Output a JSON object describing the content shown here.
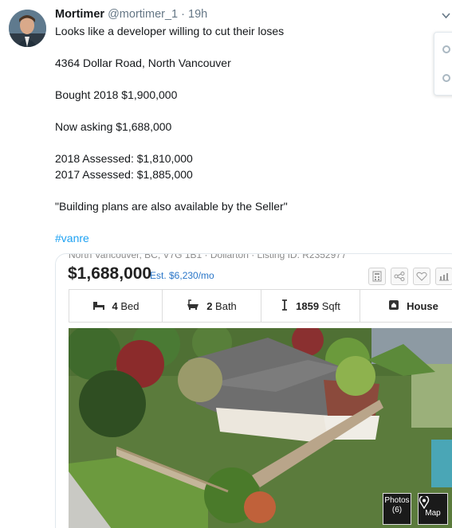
{
  "tweet": {
    "name": "Mortimer",
    "handle": "@mortimer_1",
    "separator": "·",
    "time": "19h",
    "lines": [
      "Looks like a developer willing to cut their loses",
      "4364 Dollar Road, North Vancouver",
      "Bought 2018 $1,900,000",
      "Now asking $1,688,000",
      "2018 Assessed: $1,810,000",
      "2017 Assessed: $1,885,000",
      "\"Building plans are also available by the Seller\""
    ],
    "hashtag": "#vanre"
  },
  "listing": {
    "partial_header": "North Vancouver, BC, V7G 1B1 · Dollarton · Listing ID: R2352977",
    "price": "$1,688,000",
    "estimate": "Est. $6,230/mo",
    "stats": [
      {
        "icon": "bed-icon",
        "value": "4",
        "unit": "Bed"
      },
      {
        "icon": "bath-icon",
        "value": "2",
        "unit": "Bath"
      },
      {
        "icon": "ruler-icon",
        "value": "1859",
        "unit": "Sqft"
      },
      {
        "icon": "house-icon",
        "value": "",
        "unit": "House"
      }
    ],
    "photos_label": "Photos",
    "photos_count": "(6)",
    "map_label": "Map"
  }
}
